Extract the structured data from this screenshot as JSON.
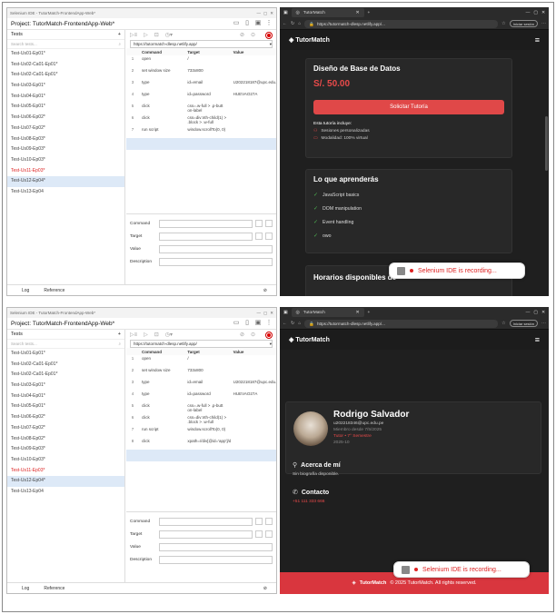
{
  "ide": {
    "title": "Selenium IDE - TutorMatch-FrontendApp-Web*",
    "project_label": "Project:",
    "project_name": "TutorMatch-FrontendApp-Web*",
    "tests_label": "Tests",
    "search_placeholder": "Search tests...",
    "base_url": "https://tutormatch-dlesp.netlify.app/",
    "col_command": "Command",
    "col_target": "Target",
    "col_value": "Value",
    "command_label": "Command",
    "target_label": "Target",
    "value_label": "Value",
    "description_label": "Description",
    "log_tab": "Log",
    "reference_tab": "Reference"
  },
  "ide1": {
    "tests": [
      "Test-Us01-Ep01*",
      "Test-Us02-Ca01-Ep01*",
      "Test-Us02-Ca01-Ep01*",
      "Test-Us03-Ep01*",
      "Test-Us04-Ep01*",
      "Test-Us05-Ep01*",
      "Test-Us06-Ep02*",
      "Test-Us07-Ep02*",
      "Test-Us08-Ep03*",
      "Test-Us09-Ep03*",
      "Test-Us10-Ep03*",
      "Test-Us11-Ep03*",
      "Test-Us12-Ep04*",
      "Test-Us13-Ep04"
    ],
    "red": [
      11
    ],
    "selected": 12,
    "rows": [
      {
        "n": "1",
        "command": "open",
        "target": "/",
        "value": ""
      },
      {
        "n": "2",
        "command": "set window size",
        "target": "733x800",
        "value": ""
      },
      {
        "n": "3",
        "command": "type",
        "target": "id=email",
        "value": "U202218187@upc.edu.pe"
      },
      {
        "n": "4",
        "command": "type",
        "target": "id=password",
        "value": "HUEVAO27A"
      },
      {
        "n": "5",
        "command": "click",
        "target": "css=.w-full > .p-butt on-label",
        "value": ""
      },
      {
        "n": "6",
        "command": "click",
        "target": "css=div:nth-child(1) > .block > .w-full",
        "value": ""
      },
      {
        "n": "7",
        "command": "run script",
        "target": "window.scrollTo(0, 0)",
        "value": ""
      }
    ]
  },
  "ide2": {
    "tests": [
      "Test-Us01-Ep01*",
      "Test-Us02-Ca01-Ep01*",
      "Test-Us02-Ca01-Ep01*",
      "Test-Us03-Ep01*",
      "Test-Us04-Ep01*",
      "Test-Us05-Ep01*",
      "Test-Us06-Ep02*",
      "Test-Us07-Ep02*",
      "Test-Us08-Ep02*",
      "Test-Us09-Ep03*",
      "Test-Us10-Ep03*",
      "Test-Us11-Ep03*",
      "Test-Us12-Ep04*",
      "Test-Us13-Ep04"
    ],
    "red": [
      11
    ],
    "selected": 12,
    "rows": [
      {
        "n": "1",
        "command": "open",
        "target": "/",
        "value": ""
      },
      {
        "n": "2",
        "command": "set window size",
        "target": "733x800",
        "value": ""
      },
      {
        "n": "3",
        "command": "type",
        "target": "id=email",
        "value": "U202218187@upc.edu.pe"
      },
      {
        "n": "4",
        "command": "type",
        "target": "id=password",
        "value": "HUEVAO27A"
      },
      {
        "n": "5",
        "command": "click",
        "target": "css=.w-full > .p-butt on-label",
        "value": ""
      },
      {
        "n": "6",
        "command": "click",
        "target": "css=div:nth-child(1) > .block > .w-full",
        "value": ""
      },
      {
        "n": "7",
        "command": "run script",
        "target": "window.scrollTo(0, 0)",
        "value": ""
      },
      {
        "n": "8",
        "command": "click",
        "target": "xpath=//div[@id='app']/div/header",
        "value": ""
      }
    ]
  },
  "browser": {
    "tab_title": "TutorMatch",
    "address": "https://tutormatch-dlesp.netlify.app/...",
    "signin": "Iniciar sesión",
    "brand": "TutorMatch"
  },
  "page1": {
    "course_title": "Diseño de Base de Datos",
    "price": "S/. 50.00",
    "request_button": "Solicitar Tutoría",
    "includes_title": "Esta tutoría incluye:",
    "includes": [
      "Sesiones personalizadas",
      "Modalidad: 100% virtual"
    ],
    "learn_title": "Lo que aprenderás",
    "learn_items": [
      "JavaScript basics",
      "DOM manipulation",
      "Event handling",
      "owo"
    ],
    "schedule_title": "Horarios disponibles de"
  },
  "page2": {
    "name": "Rodrigo Salvador",
    "email": "u202218346@upc.edu.pe",
    "member": "Miembro desde 7/5/2025",
    "cycle": "Tutor • 7° Semestre",
    "year": "2025-10",
    "about_title": "Acerca de mí",
    "about_text": "Sin biografía disponible.",
    "contact_title": "Contacto",
    "phone": "+51 111 333 666",
    "footer_brand": "TutorMatch",
    "footer_text": "© 2025 TutorMatch. All rights reserved."
  },
  "recording": "Selenium IDE is recording..."
}
